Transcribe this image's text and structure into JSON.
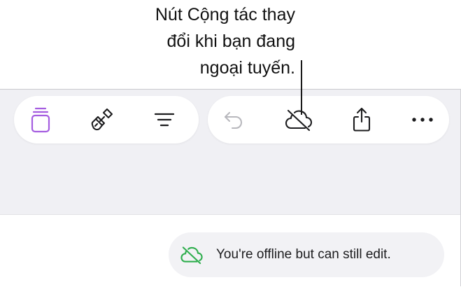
{
  "callout": {
    "lines": [
      "Nút Cộng tác thay",
      "đổi khi bạn đang",
      "ngoại tuyến."
    ]
  },
  "toolbar": {
    "left_group": [
      {
        "icon": "document-stack-icon",
        "color": "#a55ee0",
        "state": "active"
      },
      {
        "icon": "paintbrush-icon",
        "color": "#1c1c1e"
      },
      {
        "icon": "text-format-icon",
        "color": "#1c1c1e"
      }
    ],
    "right_group": [
      {
        "icon": "undo-icon",
        "color": "#b8b8bd",
        "state": "disabled"
      },
      {
        "icon": "cloud-offline-icon",
        "color": "#1c1c1e"
      },
      {
        "icon": "share-icon",
        "color": "#1c1c1e"
      },
      {
        "icon": "more-icon",
        "color": "#1c1c1e"
      }
    ]
  },
  "toast": {
    "text": "You're offline but can still edit.",
    "icon": "cloud-offline-icon",
    "icon_color": "#2fae4e"
  },
  "colors": {
    "accent": "#a55ee0",
    "toolbar_bg": "#f0f0f4",
    "offline_green": "#2fae4e"
  }
}
